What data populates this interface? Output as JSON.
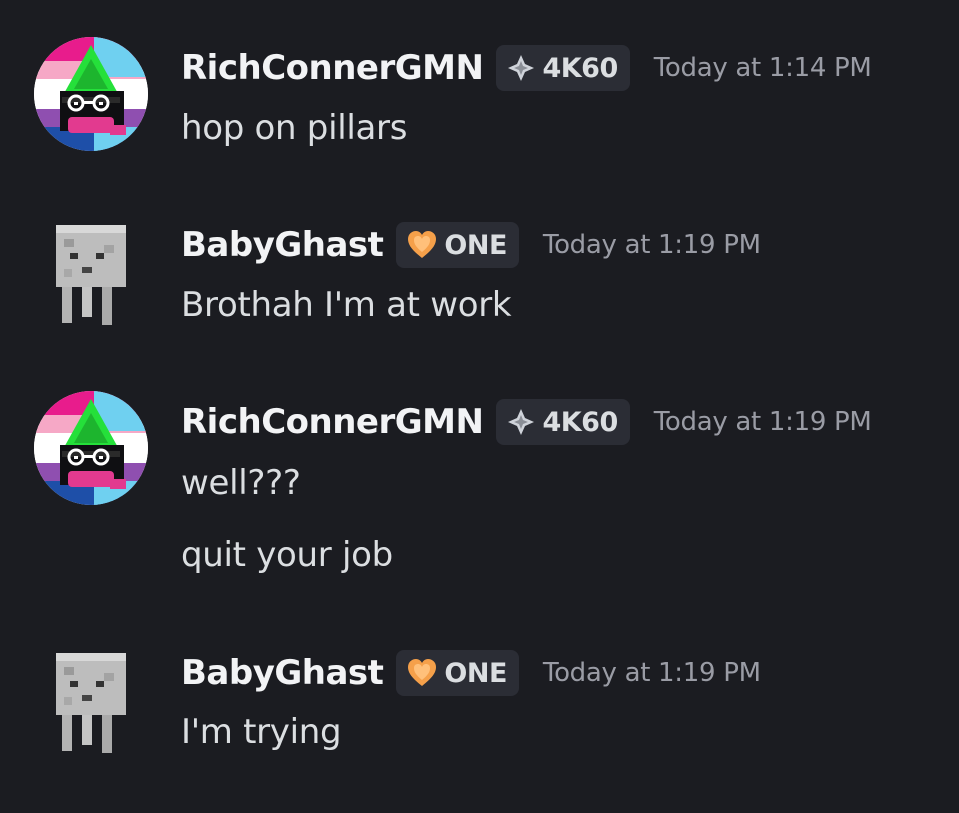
{
  "messages": [
    {
      "username": "RichConnerGMN",
      "tag": {
        "label": "4K60",
        "icon": "diamond-icon",
        "color": "#cfd3da"
      },
      "timestamp": "Today at 1:14 PM",
      "avatar": "ralsei-pride-avatar",
      "lines": [
        "hop on pillars"
      ]
    },
    {
      "username": "BabyGhast",
      "tag": {
        "label": "ONE",
        "icon": "heart-icon",
        "color": "#f5a04a"
      },
      "timestamp": "Today at 1:19 PM",
      "avatar": "minecraft-ghast-avatar",
      "lines": [
        "Brothah I'm at work"
      ]
    },
    {
      "username": "RichConnerGMN",
      "tag": {
        "label": "4K60",
        "icon": "diamond-icon",
        "color": "#cfd3da"
      },
      "timestamp": "Today at 1:19 PM",
      "avatar": "ralsei-pride-avatar",
      "lines": [
        "well???",
        "quit your job"
      ]
    },
    {
      "username": "BabyGhast",
      "tag": {
        "label": "ONE",
        "icon": "heart-icon",
        "color": "#f5a04a"
      },
      "timestamp": "Today at 1:19 PM",
      "avatar": "minecraft-ghast-avatar",
      "lines": [
        "I'm trying"
      ]
    }
  ],
  "colors": {
    "background": "#1b1c21",
    "username": "#f2f3f5",
    "message_text": "#dbdee1",
    "timestamp": "#9a9ca5",
    "tag_background": "#2b2d35"
  }
}
